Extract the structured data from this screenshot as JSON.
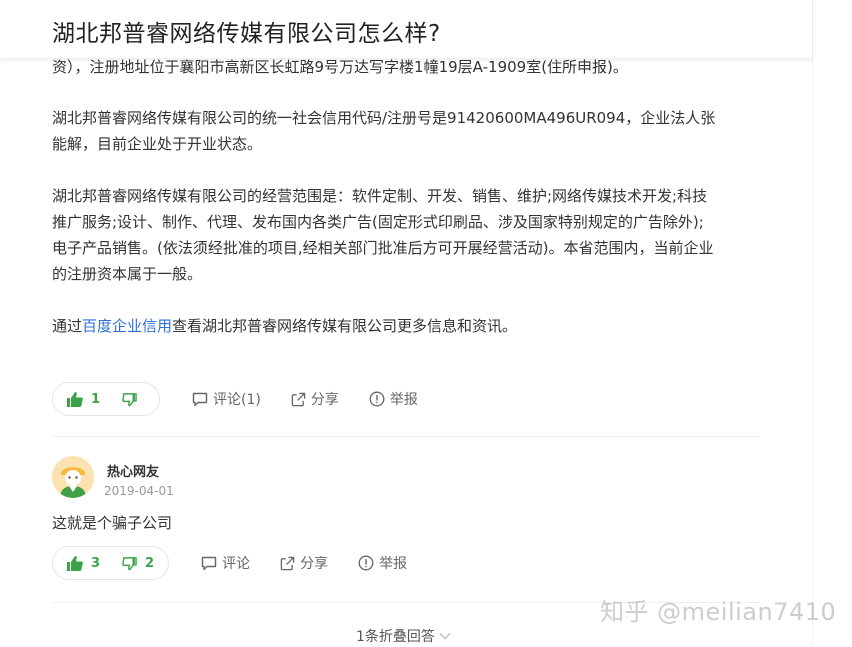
{
  "header": {
    "title": "湖北邦普睿网络传媒有限公司怎么样?"
  },
  "answer": {
    "p0": "资），注册地址位于襄阳市高新区长虹路9号万达写字楼1幢19层A-1909室(住所申报)。",
    "p1_line1": "湖北邦普睿网络传媒有限公司的统一社会信用代码/注册号是91420600MA496UR094，企业法人张",
    "p1_line2": "能解，目前企业处于开业状态。",
    "p2_line1": "湖北邦普睿网络传媒有限公司的经营范围是：软件定制、开发、销售、维护;网络传媒技术开发;科技",
    "p2_line2": "推广服务;设计、制作、代理、发布国内各类广告(固定形式印刷品、涉及国家特别规定的广告除外);",
    "p2_line3": "电子产品销售。(依法须经批准的项目,经相关部门批准后方可开展经营活动)。本省范围内，当前企业",
    "p2_line4": "的注册资本属于一般。",
    "p3_prefix": "通过",
    "p3_link": "百度企业信用",
    "p3_suffix": "查看湖北邦普睿网络传媒有限公司更多信息和资讯。"
  },
  "answer_toolbar": {
    "upvotes": "1",
    "downvotes": "",
    "comment_label": "评论(1)",
    "share_label": "分享",
    "report_label": "举报"
  },
  "reply": {
    "author": "热心网友",
    "date": "2019-04-01",
    "text": "这就是个骗子公司"
  },
  "reply_toolbar": {
    "upvotes": "3",
    "downvotes": "2",
    "comment_label": "评论",
    "share_label": "分享",
    "report_label": "举报"
  },
  "footer": {
    "folded_label": "1条折叠回答"
  },
  "watermark": "知乎 @meilian7410",
  "colors": {
    "accent_green": "#3aa34a",
    "link_blue": "#2e6fdc",
    "text": "#333333",
    "muted": "#999999"
  },
  "icons": [
    "thumb-up-icon",
    "thumb-down-icon",
    "comment-icon",
    "share-icon",
    "report-icon",
    "chevron-down-icon",
    "avatar-icon"
  ]
}
